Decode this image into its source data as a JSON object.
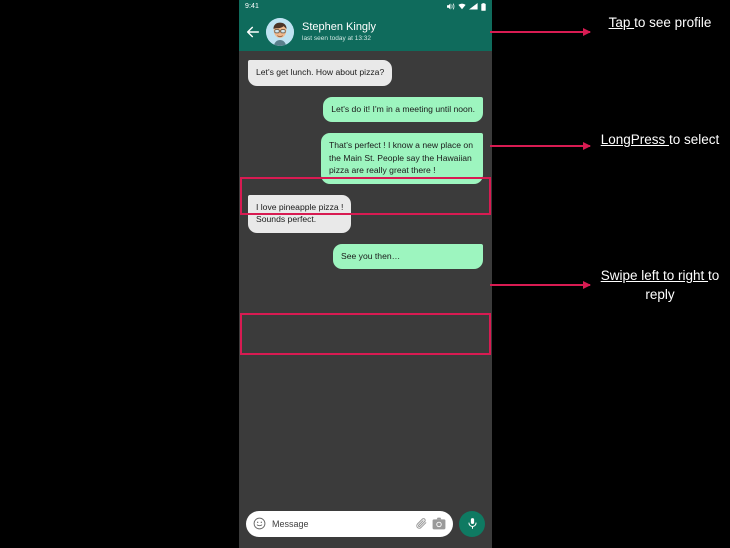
{
  "statusbar": {
    "clock": "9:41",
    "icons": [
      "volume-icon",
      "wifi-icon",
      "signal-icon",
      "battery-icon"
    ]
  },
  "header": {
    "back_icon": "back-arrow-icon",
    "avatar_icon": "avatar",
    "name": "Stephen Kingly",
    "status": "last seen today at 13:32"
  },
  "chat": {
    "messages": [
      {
        "text": "Let's get lunch. How about pizza?",
        "side": "in"
      },
      {
        "text": "Let's do it! I'm in a meeting until noon.",
        "side": "out"
      },
      {
        "text": "That's perfect ! I know a new place on the Main St. People say the Hawaiian pizza are really great there !",
        "side": "out"
      },
      {
        "text": "I love pineapple pizza !\nSounds perfect.",
        "side": "in"
      },
      {
        "text": "See you then…",
        "side": "out"
      }
    ]
  },
  "input": {
    "emoji_icon": "emoji-icon",
    "placeholder": "Message",
    "attach_icon": "paperclip-icon",
    "camera_icon": "camera-icon",
    "mic_icon": "microphone-icon"
  },
  "annotations": [
    {
      "underlined": "Tap ",
      "rest": "to see profile"
    },
    {
      "underlined": "LongPress ",
      "rest": "to select"
    },
    {
      "underlined": "Swipe left to right ",
      "rest": "to reply"
    }
  ],
  "colors": {
    "header_teal": "#0f6b5c",
    "chat_background": "#3b3b3b",
    "outgoing_bubble": "#9df5bf",
    "incoming_bubble": "#e9e9e9",
    "highlight": "#d81b52",
    "mic_button": "#0f7a62"
  }
}
